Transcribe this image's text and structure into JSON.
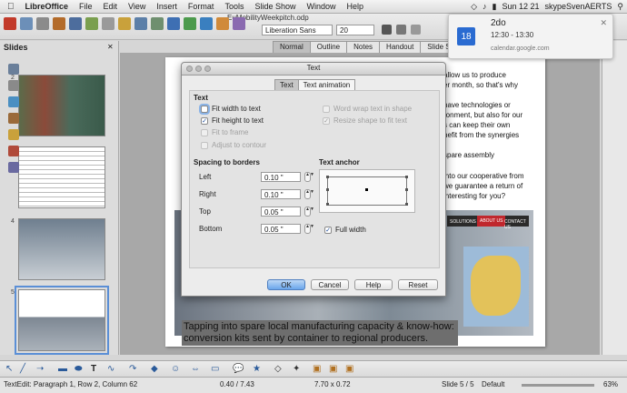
{
  "menubar": {
    "apple": "",
    "app": "LibreOffice",
    "items": [
      "File",
      "Edit",
      "View",
      "Insert",
      "Format",
      "Tools",
      "Slide Show",
      "Window",
      "Help"
    ],
    "clock": "Sun 12 21",
    "user": "skypeSvenAERTS"
  },
  "toolbar": {
    "document_title": "EuMobilityWeekpitch.odp",
    "font_name": "Liberation Sans",
    "font_size": "20"
  },
  "view_tabs": [
    "Normal",
    "Outline",
    "Notes",
    "Handout",
    "Slide Sorter"
  ],
  "slides_panel": {
    "title": "Slides",
    "numbers": [
      "2",
      "3",
      "4",
      "5"
    ]
  },
  "slide": {
    "text_lines": [
      "allow us to produce",
      "er month, so that's why",
      "have technologies or",
      "ronment, but also for our",
      "s can keep their own",
      "nefit from the synergies",
      "spare assembly",
      "into our cooperative from",
      "we guarantee a return of",
      "interesting for you?"
    ],
    "nav_items": [
      "SOLUTIONS",
      "ABOUT US",
      "CONTACT US"
    ],
    "caption": "Tapping into spare local manufacturing capacity & know-how: conversion kits sent by container to regional producers."
  },
  "notification": {
    "title": "2do",
    "time": "12:30 - 13:30",
    "source": "calendar.google.com",
    "day": "18"
  },
  "dialog": {
    "title": "Text",
    "tabs": [
      "Text",
      "Text animation"
    ],
    "section_text": "Text",
    "options": {
      "fit_width": {
        "label": "Fit width to text",
        "checked": false
      },
      "fit_height": {
        "label": "Fit height to text",
        "checked": true
      },
      "fit_frame": {
        "label": "Fit to frame",
        "checked": false
      },
      "adjust_contour": {
        "label": "Adjust to contour",
        "checked": false
      },
      "word_wrap": {
        "label": "Word wrap text in shape",
        "checked": false
      },
      "resize_shape": {
        "label": "Resize shape to fit text",
        "checked": true
      }
    },
    "spacing_title": "Spacing to borders",
    "spacing": [
      {
        "label": "Left",
        "value": "0.10 \""
      },
      {
        "label": "Right",
        "value": "0.10 \""
      },
      {
        "label": "Top",
        "value": "0.05 \""
      },
      {
        "label": "Bottom",
        "value": "0.05 \""
      }
    ],
    "anchor_title": "Text anchor",
    "full_width": {
      "label": "Full width",
      "checked": true
    },
    "buttons": {
      "ok": "OK",
      "cancel": "Cancel",
      "help": "Help",
      "reset": "Reset"
    }
  },
  "statusbar": {
    "edit_info": "TextEdit: Paragraph 1, Row 2, Column 62",
    "position": "0.40 / 7.43",
    "size": "7.70 x 0.72",
    "slide": "Slide 5 / 5",
    "layout": "Default",
    "zoom": "63%"
  },
  "colors": {
    "accent": "#3c7ee0",
    "nav_active": "#c0272d"
  }
}
